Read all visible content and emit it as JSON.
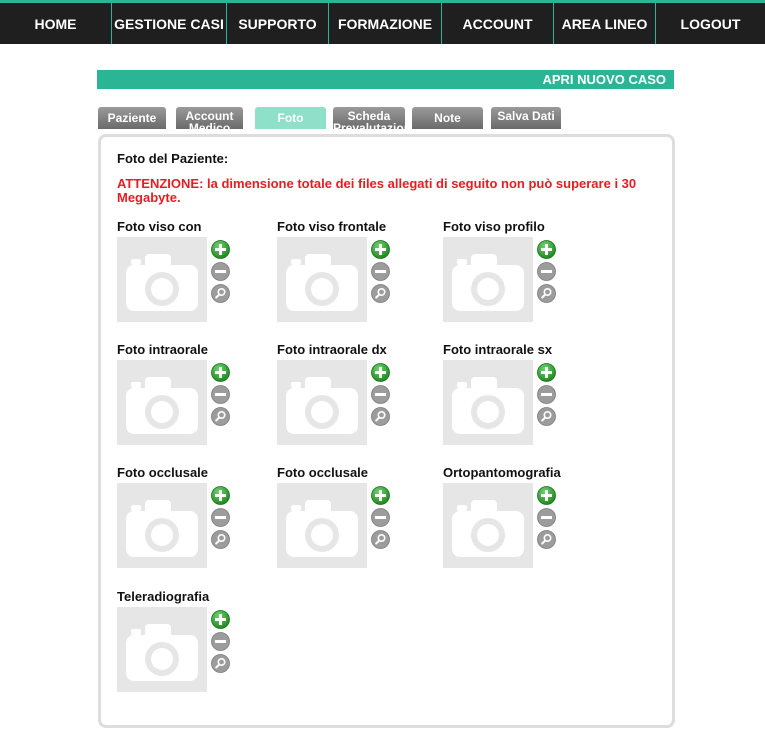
{
  "nav": {
    "items": [
      "HOME",
      "GESTIONE CASI",
      "SUPPORTO",
      "FORMAZIONE",
      "ACCOUNT",
      "AREA LINEO",
      "LOGOUT"
    ]
  },
  "title_bar": {
    "label": "APRI NUOVO CASO"
  },
  "tabs": [
    {
      "label": "Paziente"
    },
    {
      "label": "Account Medico"
    },
    {
      "label": "Foto",
      "active": true
    },
    {
      "label": "Scheda Prevalutazione"
    },
    {
      "label": "Note"
    },
    {
      "label": "Salva Dati"
    }
  ],
  "panel": {
    "heading": "Foto del Paziente:",
    "warning": "ATTENZIONE: la dimensione totale dei files allegati di seguito non può superare i 30 Megabyte."
  },
  "photos": [
    {
      "label": "Foto viso con"
    },
    {
      "label": "Foto viso frontale"
    },
    {
      "label": "Foto viso profilo"
    },
    {
      "label": "Foto intraorale"
    },
    {
      "label": "Foto intraorale dx"
    },
    {
      "label": "Foto intraorale sx"
    },
    {
      "label": "Foto occlusale"
    },
    {
      "label": "Foto occlusale"
    },
    {
      "label": "Ortopantomografia"
    },
    {
      "label": "Teleradiografia"
    }
  ],
  "icons": {
    "add": "plus-circle-icon",
    "remove": "minus-circle-icon",
    "zoom": "magnifier-icon",
    "placeholder": "camera-icon"
  },
  "colors": {
    "accent": "#2ab597",
    "nav_bg": "#1f1f1f",
    "warning": "#e81c23",
    "add_button": "#2f9e2f",
    "tab_active": "#8ee0c9"
  }
}
